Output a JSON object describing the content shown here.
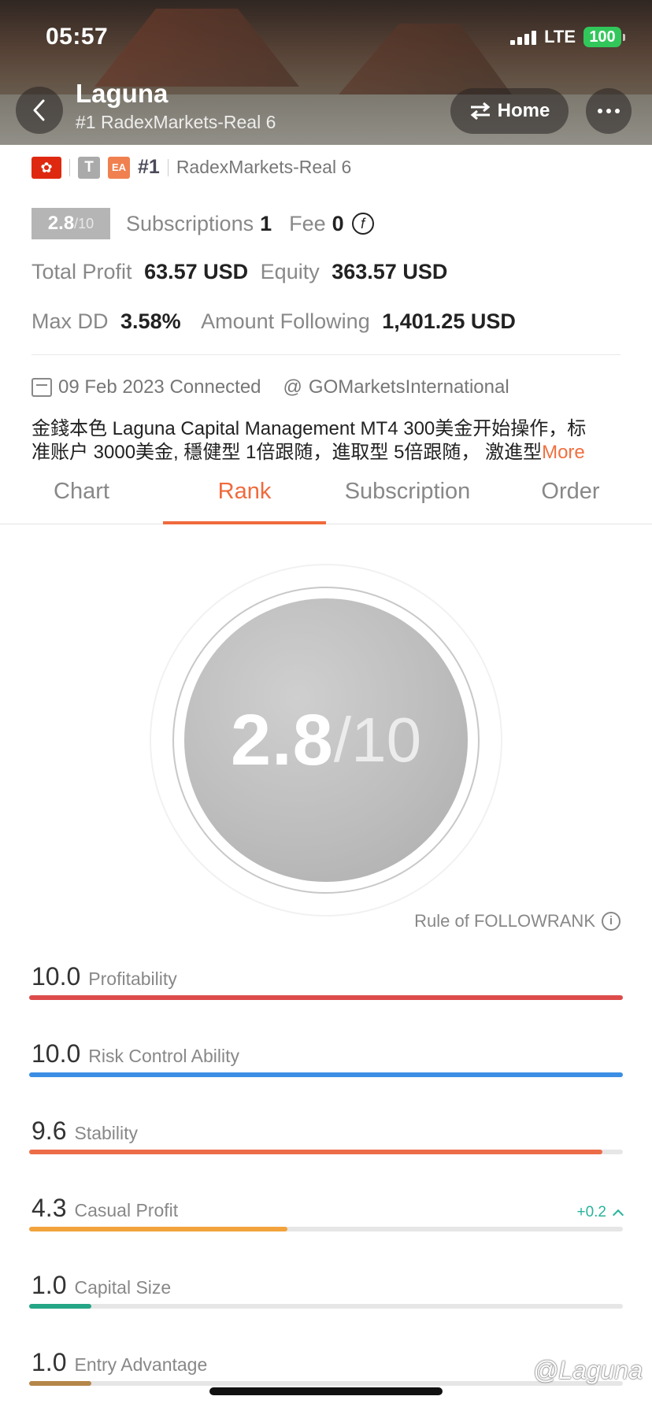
{
  "status_bar": {
    "time": "05:57",
    "network": "LTE",
    "battery": "100"
  },
  "header": {
    "title": "Laguna",
    "subtitle": "#1 RadexMarkets-Real 6",
    "home_label": "Home"
  },
  "badges": {
    "flag_icon": "hong-kong-flag",
    "t_label": "T",
    "ea_label": "EA",
    "rank": "#1",
    "broker": "RadexMarkets-Real 6"
  },
  "summary": {
    "score": "2.8",
    "score_max": "/10",
    "subscriptions_label": "Subscriptions",
    "subscriptions_value": "1",
    "fee_label": "Fee",
    "fee_value": "0",
    "total_profit_label": "Total Profit",
    "total_profit_value": "63.57 USD",
    "equity_label": "Equity",
    "equity_value": "363.57 USD",
    "max_dd_label": "Max DD",
    "max_dd_value": "3.58%",
    "amount_following_label": "Amount Following",
    "amount_following_value": "1,401.25 USD",
    "connected_text": "09 Feb 2023 Connected",
    "at_symbol": "@",
    "platform": "GOMarketsInternational",
    "description_line1": "金錢本色 Laguna Capital Management MT4 300美金开始操作，标",
    "description_line2": "准账户 3000美金, 穩健型 1倍跟随，進取型 5倍跟随， 激進型",
    "more_label": "More"
  },
  "tabs": [
    {
      "label": "Chart",
      "active": false
    },
    {
      "label": "Rank",
      "active": true
    },
    {
      "label": "Subscription",
      "active": false
    },
    {
      "label": "Order",
      "active": false
    }
  ],
  "rank_circle": {
    "score": "2.8",
    "max": "/10"
  },
  "rule_link": "Rule of FOLLOWRANK",
  "metrics": [
    {
      "value": "10.0",
      "name": "Profitability",
      "fraction": 1.0,
      "color": "#dd4b4b",
      "change": ""
    },
    {
      "value": "10.0",
      "name": "Risk Control Ability",
      "fraction": 1.0,
      "color": "#3b8ee3",
      "change": ""
    },
    {
      "value": "9.6",
      "name": "Stability",
      "fraction": 0.965,
      "color": "#ec6c48",
      "change": ""
    },
    {
      "value": "4.3",
      "name": "Casual Profit",
      "fraction": 0.435,
      "color": "#f2a33c",
      "change": "+0.2"
    },
    {
      "value": "1.0",
      "name": "Capital Size",
      "fraction": 0.105,
      "color": "#24a585",
      "change": ""
    },
    {
      "value": "1.0",
      "name": "Entry Advantage",
      "fraction": 0.105,
      "color": "#b5864a",
      "change": ""
    }
  ],
  "watermark": "@Laguna"
}
